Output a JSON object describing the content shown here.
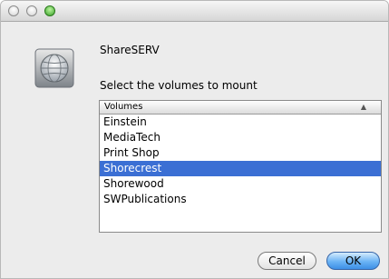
{
  "server": {
    "name": "ShareSERV",
    "icon": "network-server-globe-icon"
  },
  "prompt": "Select the volumes to mount",
  "volumes": {
    "column_header": "Volumes",
    "sort_indicator": "▲",
    "items": [
      "Einstein",
      "MediaTech",
      "Print Shop",
      "Shorecrest",
      "Shorewood",
      "SWPublications"
    ],
    "selected": "Shorecrest"
  },
  "buttons": {
    "cancel": "Cancel",
    "ok": "OK"
  },
  "colors": {
    "selection": "#3b6fd4",
    "zoom_button": "#3aa02a",
    "default_button": "#6ab3f5"
  }
}
